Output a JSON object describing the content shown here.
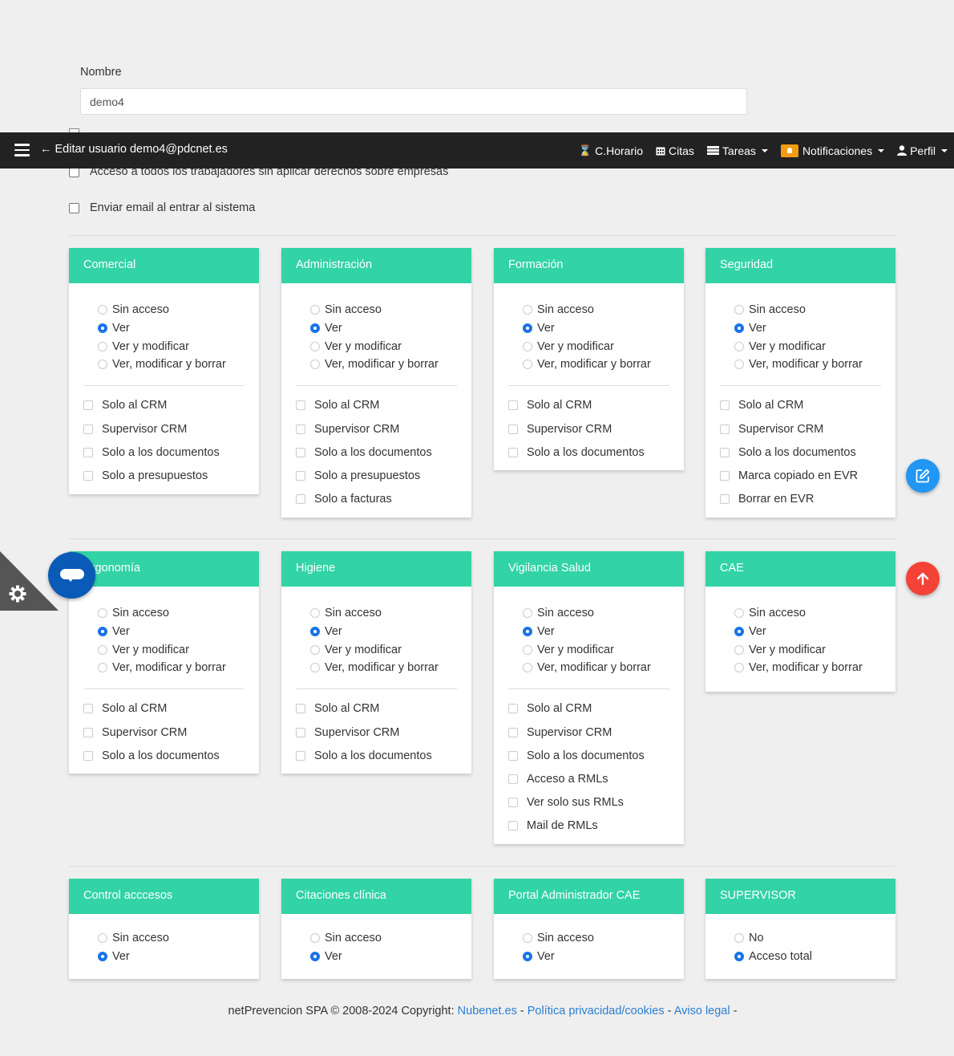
{
  "form": {
    "name_label": "Nombre",
    "name_value": "demo4",
    "check_all_workers": "Acceso a todos los trabajadores sin aplicar derechos sobre empresas",
    "check_email": "Enviar email al entrar al sistema"
  },
  "navbar": {
    "title": "Editar usuario demo4@pdcnet.es",
    "horario": "C.Horario",
    "citas": "Citas",
    "tareas": "Tareas",
    "notificaciones": "Notificaciones",
    "perfil": "Perfil"
  },
  "cards": [
    {
      "title": "Comercial",
      "radios": [
        "Sin acceso",
        "Ver",
        "Ver y modificar",
        "Ver, modificar y borrar"
      ],
      "selected": 1,
      "checks": [
        "Solo al CRM",
        "Supervisor CRM",
        "Solo a los documentos",
        "Solo a presupuestos"
      ]
    },
    {
      "title": "Administración",
      "radios": [
        "Sin acceso",
        "Ver",
        "Ver y modificar",
        "Ver, modificar y borrar"
      ],
      "selected": 1,
      "checks": [
        "Solo al CRM",
        "Supervisor CRM",
        "Solo a los documentos",
        "Solo a presupuestos",
        "Solo a facturas"
      ]
    },
    {
      "title": "Formación",
      "radios": [
        "Sin acceso",
        "Ver",
        "Ver y modificar",
        "Ver, modificar y borrar"
      ],
      "selected": 1,
      "checks": [
        "Solo al CRM",
        "Supervisor CRM",
        "Solo a los documentos"
      ]
    },
    {
      "title": "Seguridad",
      "radios": [
        "Sin acceso",
        "Ver",
        "Ver y modificar",
        "Ver, modificar y borrar"
      ],
      "selected": 1,
      "checks": [
        "Solo al CRM",
        "Supervisor CRM",
        "Solo a los documentos",
        "Marca copiado en EVR",
        "Borrar en EVR"
      ]
    },
    {
      "title": "Ergonomía",
      "radios": [
        "Sin acceso",
        "Ver",
        "Ver y modificar",
        "Ver, modificar y borrar"
      ],
      "selected": 1,
      "checks": [
        "Solo al CRM",
        "Supervisor CRM",
        "Solo a los documentos"
      ]
    },
    {
      "title": "Higiene",
      "radios": [
        "Sin acceso",
        "Ver",
        "Ver y modificar",
        "Ver, modificar y borrar"
      ],
      "selected": 1,
      "checks": [
        "Solo al CRM",
        "Supervisor CRM",
        "Solo a los documentos"
      ]
    },
    {
      "title": "Vigilancia Salud",
      "radios": [
        "Sin acceso",
        "Ver",
        "Ver y modificar",
        "Ver, modificar y borrar"
      ],
      "selected": 1,
      "checks": [
        "Solo al CRM",
        "Supervisor CRM",
        "Solo a los documentos",
        "Acceso a RMLs",
        "Ver solo sus RMLs",
        "Mail de RMLs"
      ]
    },
    {
      "title": "CAE",
      "radios": [
        "Sin acceso",
        "Ver",
        "Ver y modificar",
        "Ver, modificar y borrar"
      ],
      "selected": 1,
      "checks": []
    },
    {
      "title": "Control acccesos",
      "radios": [
        "Sin acceso",
        "Ver"
      ],
      "selected": 1,
      "checks": []
    },
    {
      "title": "Citaciones clínica",
      "radios": [
        "Sin acceso",
        "Ver"
      ],
      "selected": 1,
      "checks": []
    },
    {
      "title": "Portal Administrador CAE",
      "radios": [
        "Sin acceso",
        "Ver"
      ],
      "selected": 1,
      "checks": []
    },
    {
      "title": "SUPERVISOR",
      "radios": [
        "No",
        "Acceso total"
      ],
      "selected": 1,
      "checks": []
    }
  ],
  "footer": {
    "text": "netPrevencion SPA © 2008-2024 Copyright:",
    "link1": "Nubenet.es",
    "sep1": "-",
    "link2": "Política privacidad/cookies",
    "sep2": "-",
    "link3": "Aviso legal",
    "sep3": "-"
  },
  "icons": {
    "menu": "hamburger-icon",
    "back": "arrow-left-icon",
    "horario": "hourglass-icon",
    "citas": "calendar-icon",
    "tareas": "tasks-icon",
    "notificaciones": "bell-icon",
    "perfil": "user-icon",
    "edit": "edit-icon",
    "up": "arrow-up-icon",
    "settings": "gear-icon",
    "chat": "chat-icon"
  },
  "colors": {
    "card_header": "#32d3a6",
    "navbar": "#222222",
    "radio_selected": "#1a73e8",
    "fab_edit": "#2196f3",
    "fab_up": "#f44336",
    "chat": "#0a5bb7",
    "notification_badge": "#f39c12",
    "link": "#2a7fd1"
  }
}
